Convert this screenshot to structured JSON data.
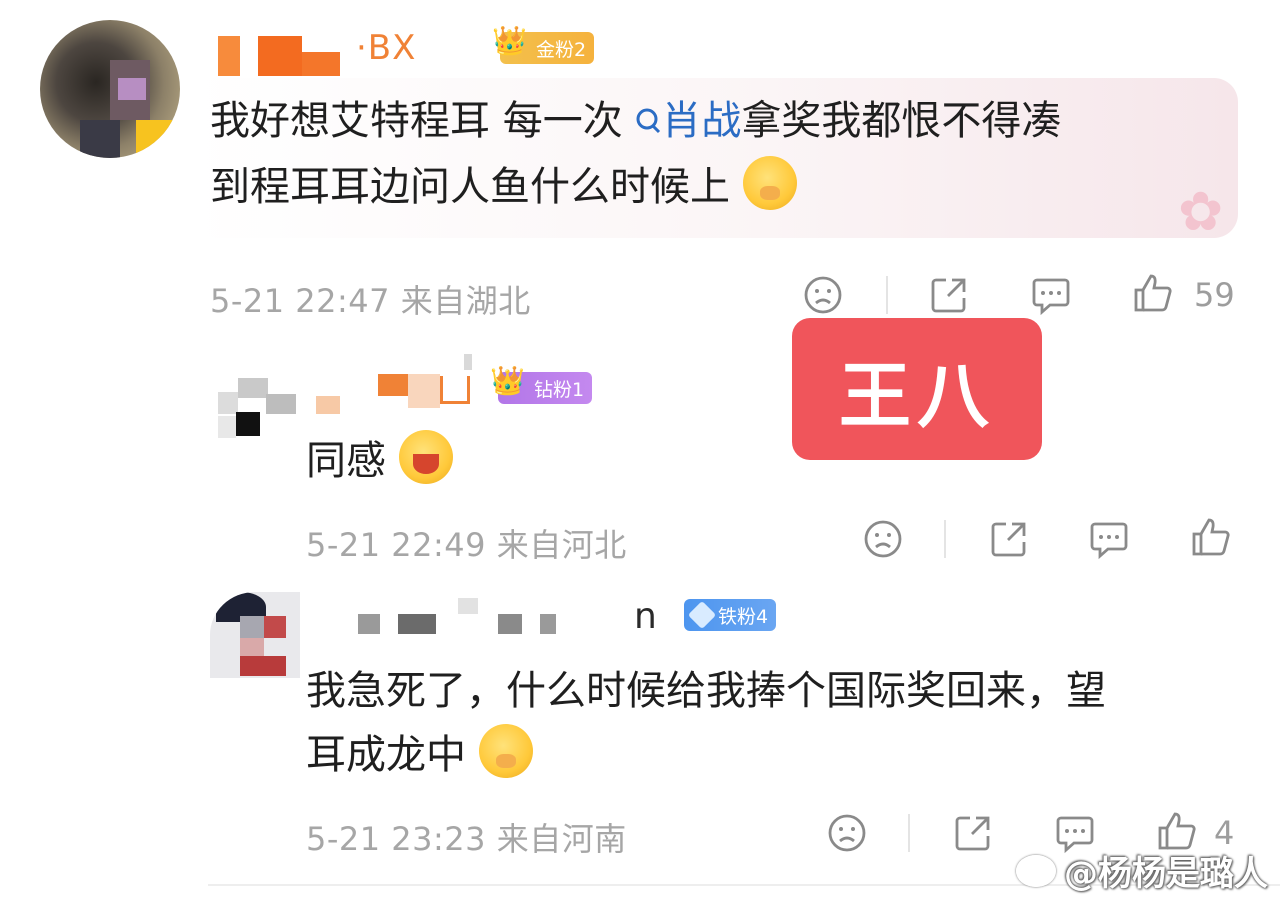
{
  "comments": [
    {
      "username_visible": "·BX",
      "badge": "金粉2",
      "text_before": "我好想艾特程耳 每一次",
      "hashtag": "肖战",
      "text_after_line1": "拿奖我都恨不得凑",
      "text_line2": "到程耳耳边问人鱼什么时候上",
      "time": "5-21 22:47",
      "location": "来自湖北",
      "likes": "59"
    },
    {
      "badge": "钻粉1",
      "text": "同感",
      "time": "5-21 22:49",
      "location": "来自河北"
    },
    {
      "username_visible": "n",
      "badge": "铁粉4",
      "text_line1": "我急死了，什么时候给我捧个国际奖回来，望",
      "text_line2": "耳成龙中",
      "time": "5-21 23:23",
      "location": "来自河南",
      "likes": "4"
    }
  ],
  "stamp": "王八",
  "watermark": "@杨杨是璐人",
  "colors": {
    "username": "#f08236",
    "hashtag": "#2b6cc4",
    "stamp_bg": "#f0555b",
    "meta": "#a6a6a6"
  },
  "icons": [
    "dislike-face-icon",
    "share-icon",
    "comment-bubble-icon",
    "thumbs-up-icon",
    "search-icon",
    "crown-icon",
    "diamond-icon",
    "lotus-icon",
    "weibo-logo-icon"
  ]
}
